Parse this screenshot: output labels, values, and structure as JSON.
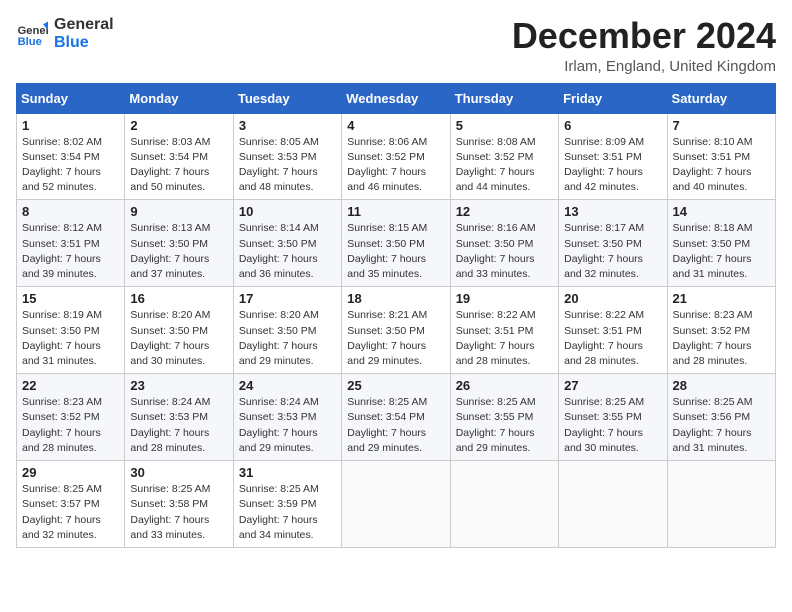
{
  "logo": {
    "line1": "General",
    "line2": "Blue"
  },
  "title": "December 2024",
  "location": "Irlam, England, United Kingdom",
  "days_of_week": [
    "Sunday",
    "Monday",
    "Tuesday",
    "Wednesday",
    "Thursday",
    "Friday",
    "Saturday"
  ],
  "weeks": [
    [
      {
        "day": "1",
        "sunrise": "8:02 AM",
        "sunset": "3:54 PM",
        "daylight": "7 hours and 52 minutes."
      },
      {
        "day": "2",
        "sunrise": "8:03 AM",
        "sunset": "3:54 PM",
        "daylight": "7 hours and 50 minutes."
      },
      {
        "day": "3",
        "sunrise": "8:05 AM",
        "sunset": "3:53 PM",
        "daylight": "7 hours and 48 minutes."
      },
      {
        "day": "4",
        "sunrise": "8:06 AM",
        "sunset": "3:52 PM",
        "daylight": "7 hours and 46 minutes."
      },
      {
        "day": "5",
        "sunrise": "8:08 AM",
        "sunset": "3:52 PM",
        "daylight": "7 hours and 44 minutes."
      },
      {
        "day": "6",
        "sunrise": "8:09 AM",
        "sunset": "3:51 PM",
        "daylight": "7 hours and 42 minutes."
      },
      {
        "day": "7",
        "sunrise": "8:10 AM",
        "sunset": "3:51 PM",
        "daylight": "7 hours and 40 minutes."
      }
    ],
    [
      {
        "day": "8",
        "sunrise": "8:12 AM",
        "sunset": "3:51 PM",
        "daylight": "7 hours and 39 minutes."
      },
      {
        "day": "9",
        "sunrise": "8:13 AM",
        "sunset": "3:50 PM",
        "daylight": "7 hours and 37 minutes."
      },
      {
        "day": "10",
        "sunrise": "8:14 AM",
        "sunset": "3:50 PM",
        "daylight": "7 hours and 36 minutes."
      },
      {
        "day": "11",
        "sunrise": "8:15 AM",
        "sunset": "3:50 PM",
        "daylight": "7 hours and 35 minutes."
      },
      {
        "day": "12",
        "sunrise": "8:16 AM",
        "sunset": "3:50 PM",
        "daylight": "7 hours and 33 minutes."
      },
      {
        "day": "13",
        "sunrise": "8:17 AM",
        "sunset": "3:50 PM",
        "daylight": "7 hours and 32 minutes."
      },
      {
        "day": "14",
        "sunrise": "8:18 AM",
        "sunset": "3:50 PM",
        "daylight": "7 hours and 31 minutes."
      }
    ],
    [
      {
        "day": "15",
        "sunrise": "8:19 AM",
        "sunset": "3:50 PM",
        "daylight": "7 hours and 31 minutes."
      },
      {
        "day": "16",
        "sunrise": "8:20 AM",
        "sunset": "3:50 PM",
        "daylight": "7 hours and 30 minutes."
      },
      {
        "day": "17",
        "sunrise": "8:20 AM",
        "sunset": "3:50 PM",
        "daylight": "7 hours and 29 minutes."
      },
      {
        "day": "18",
        "sunrise": "8:21 AM",
        "sunset": "3:50 PM",
        "daylight": "7 hours and 29 minutes."
      },
      {
        "day": "19",
        "sunrise": "8:22 AM",
        "sunset": "3:51 PM",
        "daylight": "7 hours and 28 minutes."
      },
      {
        "day": "20",
        "sunrise": "8:22 AM",
        "sunset": "3:51 PM",
        "daylight": "7 hours and 28 minutes."
      },
      {
        "day": "21",
        "sunrise": "8:23 AM",
        "sunset": "3:52 PM",
        "daylight": "7 hours and 28 minutes."
      }
    ],
    [
      {
        "day": "22",
        "sunrise": "8:23 AM",
        "sunset": "3:52 PM",
        "daylight": "7 hours and 28 minutes."
      },
      {
        "day": "23",
        "sunrise": "8:24 AM",
        "sunset": "3:53 PM",
        "daylight": "7 hours and 28 minutes."
      },
      {
        "day": "24",
        "sunrise": "8:24 AM",
        "sunset": "3:53 PM",
        "daylight": "7 hours and 29 minutes."
      },
      {
        "day": "25",
        "sunrise": "8:25 AM",
        "sunset": "3:54 PM",
        "daylight": "7 hours and 29 minutes."
      },
      {
        "day": "26",
        "sunrise": "8:25 AM",
        "sunset": "3:55 PM",
        "daylight": "7 hours and 29 minutes."
      },
      {
        "day": "27",
        "sunrise": "8:25 AM",
        "sunset": "3:55 PM",
        "daylight": "7 hours and 30 minutes."
      },
      {
        "day": "28",
        "sunrise": "8:25 AM",
        "sunset": "3:56 PM",
        "daylight": "7 hours and 31 minutes."
      }
    ],
    [
      {
        "day": "29",
        "sunrise": "8:25 AM",
        "sunset": "3:57 PM",
        "daylight": "7 hours and 32 minutes."
      },
      {
        "day": "30",
        "sunrise": "8:25 AM",
        "sunset": "3:58 PM",
        "daylight": "7 hours and 33 minutes."
      },
      {
        "day": "31",
        "sunrise": "8:25 AM",
        "sunset": "3:59 PM",
        "daylight": "7 hours and 34 minutes."
      },
      null,
      null,
      null,
      null
    ]
  ]
}
